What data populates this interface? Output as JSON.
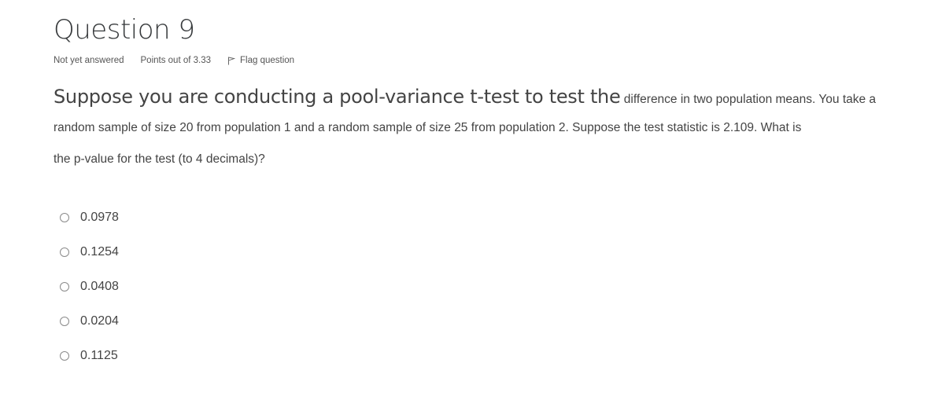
{
  "question": {
    "title": "Question 9",
    "state": "Not yet answered",
    "grade": "Points out of 3.33",
    "flag_label": "Flag question"
  },
  "text": {
    "line1_big": "Suppose you are conducting a pool-variance t-test to test the",
    "line1_small": " difference in two population means.  You take a",
    "line2": "random sample of size 20 from population 1 and a random sample of size 25 from population 2.  Suppose the test statistic is 2.109.  What is",
    "line3": "the p-value for the test (to 4 decimals)?"
  },
  "answers": [
    {
      "label": "0.0978"
    },
    {
      "label": "0.1254"
    },
    {
      "label": "0.0408"
    },
    {
      "label": "0.0204"
    },
    {
      "label": "0.1125"
    }
  ]
}
